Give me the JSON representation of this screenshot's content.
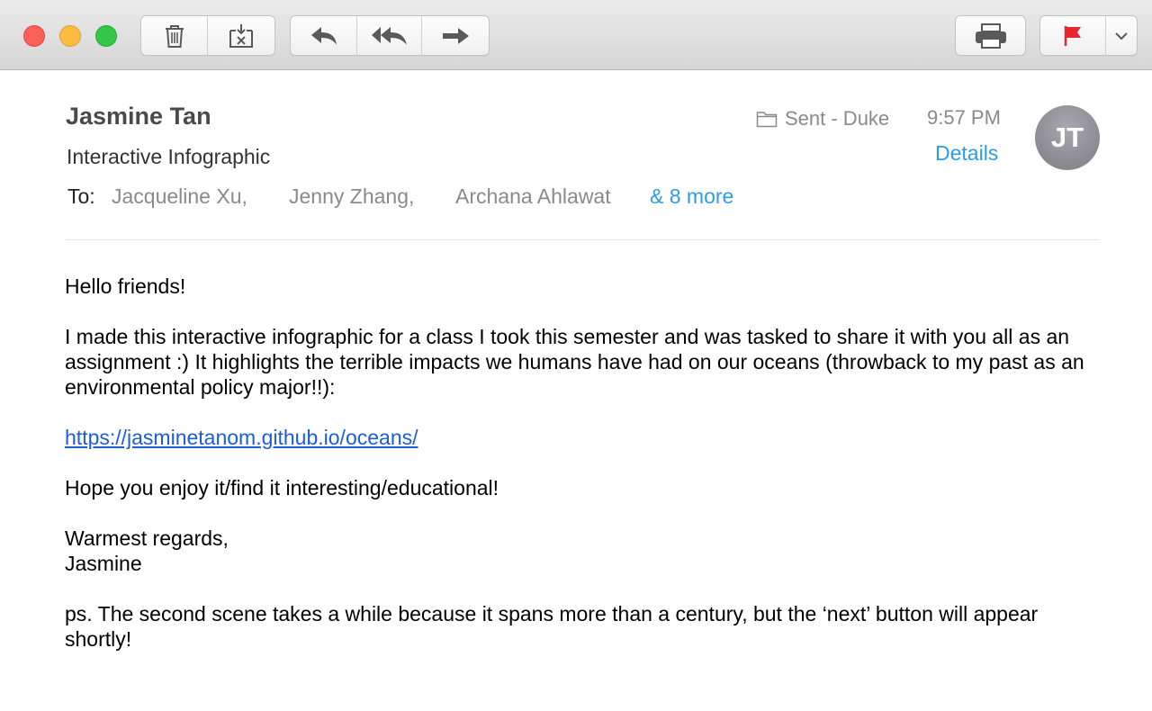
{
  "window": {
    "traffic_lights": [
      "close",
      "minimize",
      "zoom"
    ]
  },
  "toolbar": {
    "delete_icon": "trash-icon",
    "junk_icon": "junk-icon",
    "reply_icon": "reply-icon",
    "reply_all_icon": "reply-all-icon",
    "forward_icon": "forward-icon",
    "print_icon": "print-icon",
    "flag_icon": "flag-icon",
    "flag_color": "#e8262f",
    "flag_menu_icon": "chevron-down-icon"
  },
  "header": {
    "sender": "Jasmine Tan",
    "subject": "Interactive Infographic",
    "to_label": "To:",
    "recipients": [
      "Jacqueline Xu,",
      "Jenny Zhang,",
      "Archana Ahlawat"
    ],
    "more": "& 8 more",
    "mailbox": "Sent - Duke",
    "time": "9:57 PM",
    "details": "Details",
    "avatar_initials": "JT"
  },
  "body": {
    "greeting": "Hello friends!",
    "paragraph1": "I made this interactive infographic for a class I took this semester and was tasked to share it with you all as an assignment :) It highlights the terrible impacts we humans have had on our oceans (throwback to my past as an environmental policy major!!):",
    "link": "https://jasminetanom.github.io/oceans/",
    "paragraph2": "Hope you enjoy it/find it interesting/educational!",
    "signoff": "Warmest regards,",
    "signature": "Jasmine",
    "ps": "ps. The second scene takes a while because it spans more than a century, but the ‘next’ button will appear shortly!"
  },
  "colors": {
    "accent": "#2b9de8",
    "link": "#1a5fd6"
  }
}
